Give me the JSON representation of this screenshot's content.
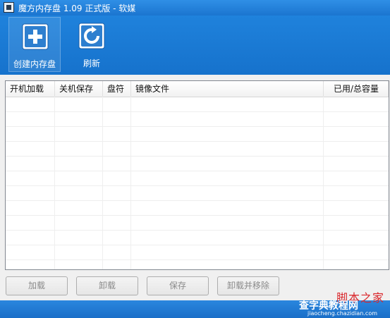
{
  "window": {
    "title": "魔方内存盘 1.09 正式版 - 软媒"
  },
  "toolbar": {
    "create_label": "创建内存盘",
    "refresh_label": "刷新"
  },
  "list": {
    "columns": [
      "开机加载",
      "关机保存",
      "盘符",
      "镜像文件",
      "已用/总容量"
    ],
    "rows": []
  },
  "buttons": {
    "load": "加载",
    "unload": "卸载",
    "save": "保存",
    "unload_remove": "卸载并移除"
  },
  "watermark": {
    "logo": "脚本之家",
    "site": "查字典教程网",
    "url": "jiaocheng.chazidian.com"
  }
}
